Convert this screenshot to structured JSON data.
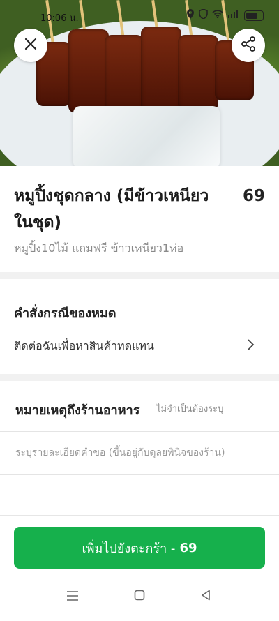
{
  "status_bar": {
    "time": "10:06 น."
  },
  "hero": {
    "close_icon": "close-icon",
    "share_icon": "share-icon"
  },
  "item": {
    "title": "หมูปิ้งชุดกลาง (มีข้าวเหนียวในชุด)",
    "price": "69",
    "description": "หมูปิ้ง10ไม้ แถมฟรี ข้าวเหนียว1ห่อ"
  },
  "out_of_stock": {
    "heading": "คำสั่งกรณีของหมด",
    "option": "ติดต่อฉันเพื่อหาสินค้าทดแทน"
  },
  "note": {
    "heading": "หมายเหตุถึงร้านอาหาร",
    "optional_label": "ไม่จำเป็นต้องระบุ",
    "placeholder": "ระบุรายละเอียดคำขอ (ขึ้นอยู่กับดุลยพินิจของร้าน)"
  },
  "cta": {
    "label": "เพิ่มไปยังตะกร้า -",
    "price": "69"
  },
  "colors": {
    "accent": "#16b04c"
  },
  "nav": {
    "menu": "≡",
    "home": "▢",
    "back": "◁"
  }
}
